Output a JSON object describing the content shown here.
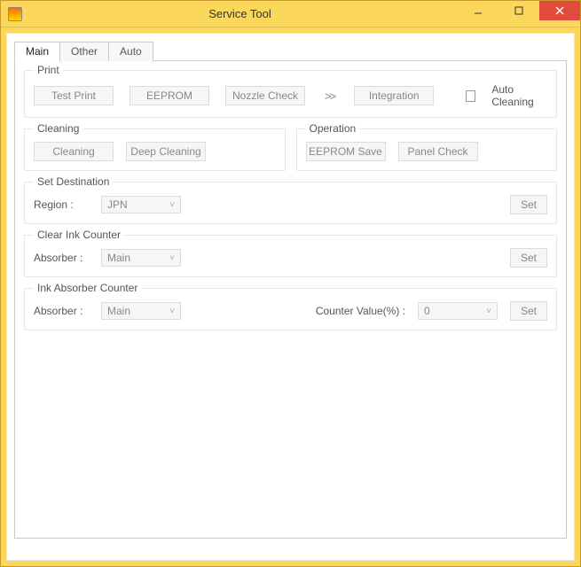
{
  "window": {
    "title": "Service Tool"
  },
  "tabs": {
    "main": "Main",
    "other": "Other",
    "auto": "Auto"
  },
  "print": {
    "legend": "Print",
    "test_print": "Test Print",
    "eeprom": "EEPROM",
    "nozzle_check": "Nozzle Check",
    "integration": "Integration",
    "auto_cleaning": "Auto Cleaning"
  },
  "cleaning": {
    "legend": "Cleaning",
    "cleaning": "Cleaning",
    "deep_cleaning": "Deep Cleaning"
  },
  "operation": {
    "legend": "Operation",
    "eeprom_save": "EEPROM Save",
    "panel_check": "Panel Check"
  },
  "set_destination": {
    "legend": "Set Destination",
    "region_label": "Region :",
    "region_value": "JPN",
    "set": "Set"
  },
  "clear_ink": {
    "legend": "Clear Ink Counter",
    "absorber_label": "Absorber :",
    "absorber_value": "Main",
    "set": "Set"
  },
  "ink_absorber": {
    "legend": "Ink Absorber Counter",
    "absorber_label": "Absorber :",
    "absorber_value": "Main",
    "counter_label": "Counter Value(%) :",
    "counter_value": "0",
    "set": "Set"
  }
}
